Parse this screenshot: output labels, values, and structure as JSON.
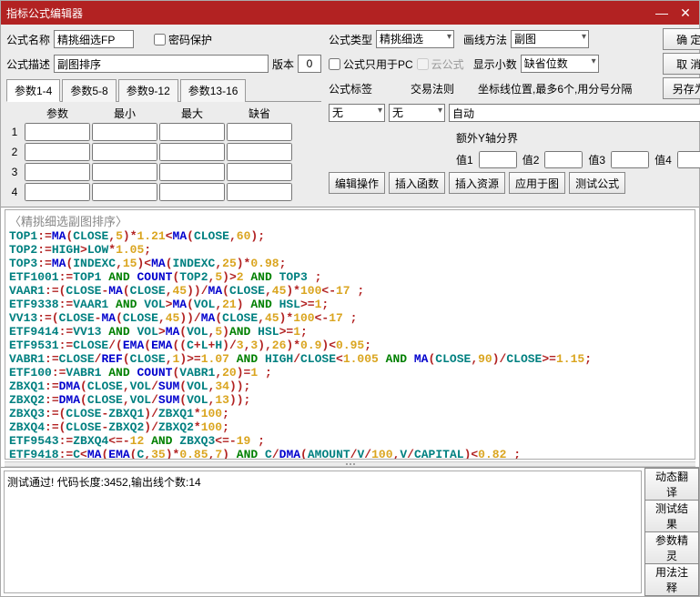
{
  "title": "指标公式编辑器",
  "labels": {
    "name": "公式名称",
    "pwd": "密码保护",
    "desc": "公式描述",
    "ver": "版本",
    "ftype": "公式类型",
    "draw": "画线方法",
    "pconly": "公式只用于PC",
    "cloud": "云公式",
    "showdec": "显示小数",
    "ftag": "公式标签",
    "trule": "交易法则",
    "coord": "坐标线位置,最多6个,用分号分隔",
    "extray": "额外Y轴分界",
    "v1": "值1",
    "v2": "值2",
    "v3": "值3",
    "v4": "值4",
    "param_tabs": [
      "参数1-4",
      "参数5-8",
      "参数9-12",
      "参数13-16"
    ],
    "param_hdrs": [
      "参数",
      "最小",
      "最大",
      "缺省"
    ]
  },
  "values": {
    "name": "精挑细选FP",
    "desc": "副图排序",
    "ver": "0",
    "ftype": "精挑细选",
    "draw": "副图",
    "defdigits": "缺省位数",
    "ftag": "无",
    "trule": "无",
    "coord": "自动"
  },
  "buttons": {
    "ok": "确 定",
    "cancel": "取 消",
    "saveas": "另存为",
    "editop": "编辑操作",
    "insfn": "插入函数",
    "insres": "插入资源",
    "apply": "应用于图",
    "test": "测试公式",
    "dyntr": "动态翻译",
    "testres": "测试结果",
    "paramwiz": "参数精灵",
    "usage": "用法注释"
  },
  "code_header": "〈精挑细选副图排序〉",
  "status": "测试通过! 代码长度:3452,输出线个数:14",
  "param_rows": [
    "1",
    "2",
    "3",
    "4"
  ]
}
